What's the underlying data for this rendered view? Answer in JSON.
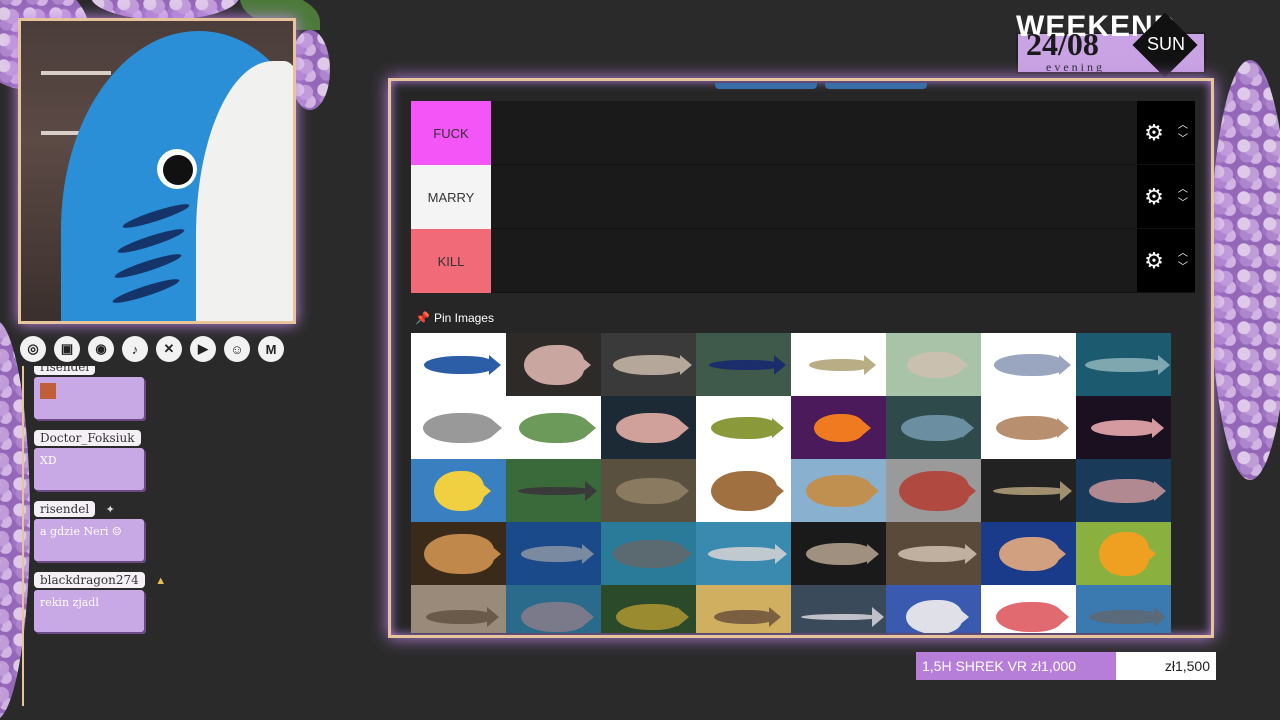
{
  "chat": [
    {
      "name": "risendel",
      "message": ""
    },
    {
      "name": "Doctor_Foksiuk",
      "message": "XD"
    },
    {
      "name": "risendel",
      "message": "a gdzie Neri"
    },
    {
      "name": "blackdragon274",
      "message": "rekin zjadl"
    }
  ],
  "socials": [
    {
      "icon": "kick-icon",
      "glyph": "◎"
    },
    {
      "icon": "twitch-icon",
      "glyph": "▣"
    },
    {
      "icon": "instagram-icon",
      "glyph": "◉"
    },
    {
      "icon": "tiktok-icon",
      "glyph": "♪"
    },
    {
      "icon": "x-icon",
      "glyph": "✕"
    },
    {
      "icon": "youtube-icon",
      "glyph": "▶"
    },
    {
      "icon": "discord-icon",
      "glyph": "☺"
    },
    {
      "icon": "gmail-icon",
      "glyph": "M"
    }
  ],
  "weekend": {
    "title": "WEEKEND",
    "date": "24/08",
    "day": "SUN",
    "subtitle": "evening"
  },
  "tiers": [
    {
      "label": "FUCK",
      "color": "#f455f7"
    },
    {
      "label": "MARRY",
      "color": "#f4f4f4"
    },
    {
      "label": "KILL",
      "color": "#f06a78"
    }
  ],
  "pin_images_label": "Pin Images",
  "donation": {
    "goal": "1,5H SHREK VR zł1,000",
    "total": "zł1,500"
  },
  "fish_images": [
    {
      "bg": "#ffffff",
      "body": "#2c5ea8",
      "w": 70,
      "h": 18
    },
    {
      "bg": "#2d2a27",
      "body": "#c9a7a0",
      "w": 60,
      "h": 40
    },
    {
      "bg": "#3a3a3a",
      "body": "#b5a89a",
      "w": 72,
      "h": 20
    },
    {
      "bg": "#3f5a4a",
      "body": "#1c2d6b",
      "w": 70,
      "h": 10
    },
    {
      "bg": "#ffffff",
      "body": "#b9ad85",
      "w": 60,
      "h": 12
    },
    {
      "bg": "#a8c3a8",
      "body": "#c9c0b0",
      "w": 54,
      "h": 26
    },
    {
      "bg": "#ffffff",
      "body": "#9aa6c0",
      "w": 70,
      "h": 22
    },
    {
      "bg": "#1c5a70",
      "body": "#7fa7b0",
      "w": 78,
      "h": 14
    },
    {
      "bg": "#ffffff",
      "body": "#999999",
      "w": 72,
      "h": 30
    },
    {
      "bg": "#ffffff",
      "body": "#6b9a5a",
      "w": 70,
      "h": 30
    },
    {
      "bg": "#1b2a35",
      "body": "#d0a09a",
      "w": 66,
      "h": 30
    },
    {
      "bg": "#ffffff",
      "body": "#8a9a3a",
      "w": 66,
      "h": 22
    },
    {
      "bg": "#4a1a5a",
      "body": "#f07a20",
      "w": 50,
      "h": 28
    },
    {
      "bg": "#2e4a4a",
      "body": "#6b8ea0",
      "w": 66,
      "h": 26
    },
    {
      "bg": "#ffffff",
      "body": "#b89070",
      "w": 66,
      "h": 24
    },
    {
      "bg": "#1a1020",
      "body": "#d59aa0",
      "w": 66,
      "h": 16
    },
    {
      "bg": "#3a80c0",
      "body": "#f0d040",
      "w": 50,
      "h": 40
    },
    {
      "bg": "#3a6a3a",
      "body": "#3a3a3a",
      "w": 72,
      "h": 8
    },
    {
      "bg": "#5a5040",
      "body": "#8a7a60",
      "w": 66,
      "h": 26
    },
    {
      "bg": "#ffffff",
      "body": "#a07040",
      "w": 66,
      "h": 40
    },
    {
      "bg": "#8ab0d0",
      "body": "#c09050",
      "w": 66,
      "h": 32
    },
    {
      "bg": "#9a9a9a",
      "body": "#b04a40",
      "w": 70,
      "h": 40
    },
    {
      "bg": "#222222",
      "body": "#a09070",
      "w": 72,
      "h": 8
    },
    {
      "bg": "#1a3a5a",
      "body": "#b08a90",
      "w": 70,
      "h": 24
    },
    {
      "bg": "#3a2a1a",
      "body": "#c0884a",
      "w": 70,
      "h": 40
    },
    {
      "bg": "#1a4a8a",
      "body": "#7a8aa0",
      "w": 66,
      "h": 16
    },
    {
      "bg": "#2a7a9a",
      "body": "#5a6a70",
      "w": 72,
      "h": 28
    },
    {
      "bg": "#3a8ab0",
      "body": "#c0c8d0",
      "w": 72,
      "h": 14
    },
    {
      "bg": "#1a1a1a",
      "body": "#a09080",
      "w": 66,
      "h": 22
    },
    {
      "bg": "#5a4a3a",
      "body": "#c0b0a0",
      "w": 72,
      "h": 16
    },
    {
      "bg": "#1a3a8a",
      "body": "#d0a080",
      "w": 60,
      "h": 34
    },
    {
      "bg": "#8ab040",
      "body": "#f0a020",
      "w": 50,
      "h": 44
    },
    {
      "bg": "#9a8a7a",
      "body": "#6a5a4a",
      "w": 66,
      "h": 14
    },
    {
      "bg": "#2a6a8a",
      "body": "#7a7a8a",
      "w": 66,
      "h": 30
    },
    {
      "bg": "#2a4a2a",
      "body": "#9a8a30",
      "w": 66,
      "h": 26
    },
    {
      "bg": "#d0b060",
      "body": "#7a6040",
      "w": 60,
      "h": 14
    },
    {
      "bg": "#3a4a5a",
      "body": "#c0c0c8",
      "w": 76,
      "h": 6
    },
    {
      "bg": "#3a5ab0",
      "body": "#e0e0e8",
      "w": 56,
      "h": 34
    },
    {
      "bg": "#ffffff",
      "body": "#e06a70",
      "w": 66,
      "h": 30
    },
    {
      "bg": "#3a7ab0",
      "body": "#5a6a7a",
      "w": 70,
      "h": 14
    }
  ]
}
